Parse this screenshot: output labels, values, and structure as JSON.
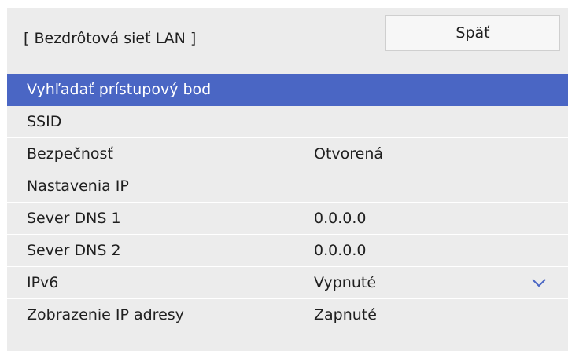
{
  "header": {
    "title": "[ Bezdrôtová sieť LAN ]",
    "back_label": "Späť"
  },
  "menu": {
    "items": [
      {
        "label": "Vyhľadať prístupový bod",
        "value": "",
        "selected": true
      },
      {
        "label": "SSID",
        "value": ""
      },
      {
        "label": "Bezpečnosť",
        "value": "Otvorená"
      },
      {
        "label": "Nastavenia IP",
        "value": ""
      },
      {
        "label": "Sever DNS 1",
        "value": "0.0.0.0"
      },
      {
        "label": "Sever DNS 2",
        "value": "0.0.0.0"
      },
      {
        "label": "IPv6",
        "value": "Vypnuté"
      },
      {
        "label": "Zobrazenie IP adresy",
        "value": "Zapnuté"
      }
    ]
  },
  "icons": {
    "scroll_down": "chevron-down-icon"
  },
  "colors": {
    "panel_background": "#ececec",
    "selection": "#4a66c4",
    "selected_text": "#ffffff",
    "accent_icon": "#4a66c4"
  }
}
